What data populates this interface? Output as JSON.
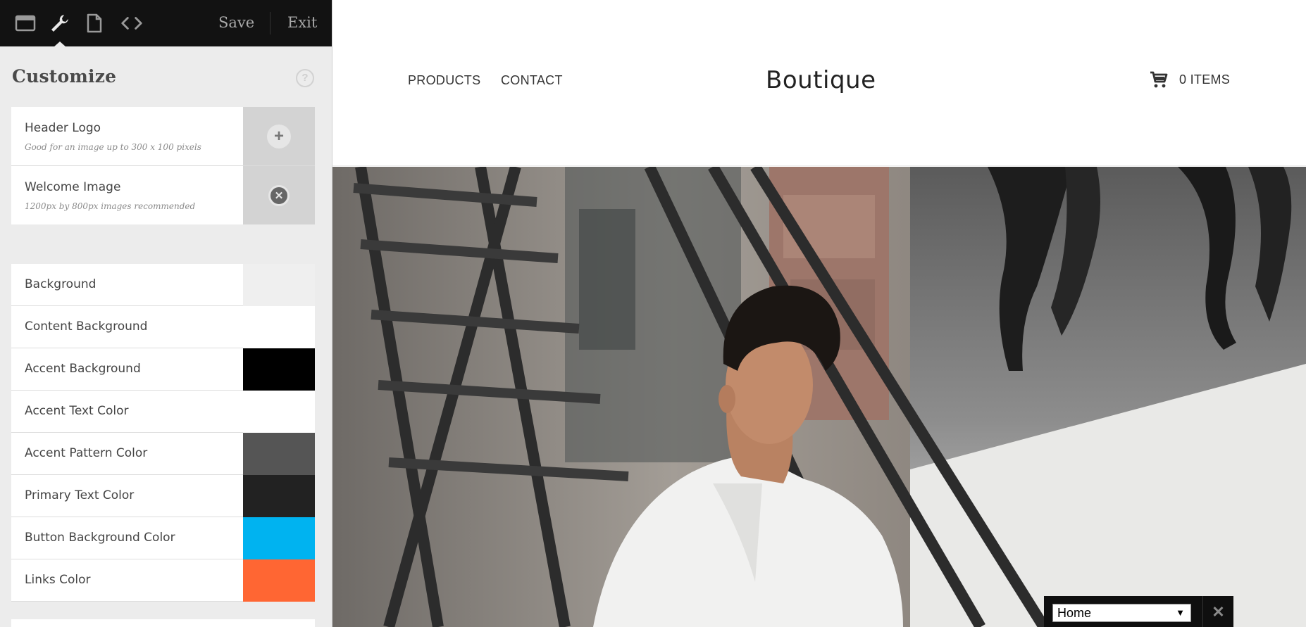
{
  "toolbar": {
    "icons": [
      "window-icon",
      "wrench-icon",
      "page-icon",
      "code-icon"
    ],
    "save_label": "Save",
    "exit_label": "Exit"
  },
  "customize": {
    "title": "Customize",
    "help": "?",
    "image_settings": [
      {
        "title": "Header Logo",
        "hint": "Good for an image up to 300 x 100 pixels",
        "action": "add"
      },
      {
        "title": "Welcome Image",
        "hint": "1200px by 800px images recommended",
        "action": "remove"
      }
    ],
    "colors": [
      {
        "label": "Background",
        "color": "#efefef"
      },
      {
        "label": "Content Background",
        "color": "#ffffff"
      },
      {
        "label": "Accent Background",
        "color": "#000000"
      },
      {
        "label": "Accent Text Color",
        "color": "#ffffff"
      },
      {
        "label": "Accent Pattern Color",
        "color": "#555555"
      },
      {
        "label": "Primary Text Color",
        "color": "#222222"
      },
      {
        "label": "Button Background Color",
        "color": "#00b3f0"
      },
      {
        "label": "Links Color",
        "color": "#ff6633"
      }
    ]
  },
  "site": {
    "nav": [
      "PRODUCTS",
      "CONTACT"
    ],
    "brand": "Boutique",
    "cart_label": "0 ITEMS"
  },
  "page_switcher": {
    "selected": "Home",
    "arrow": "▼",
    "close": "✕"
  }
}
